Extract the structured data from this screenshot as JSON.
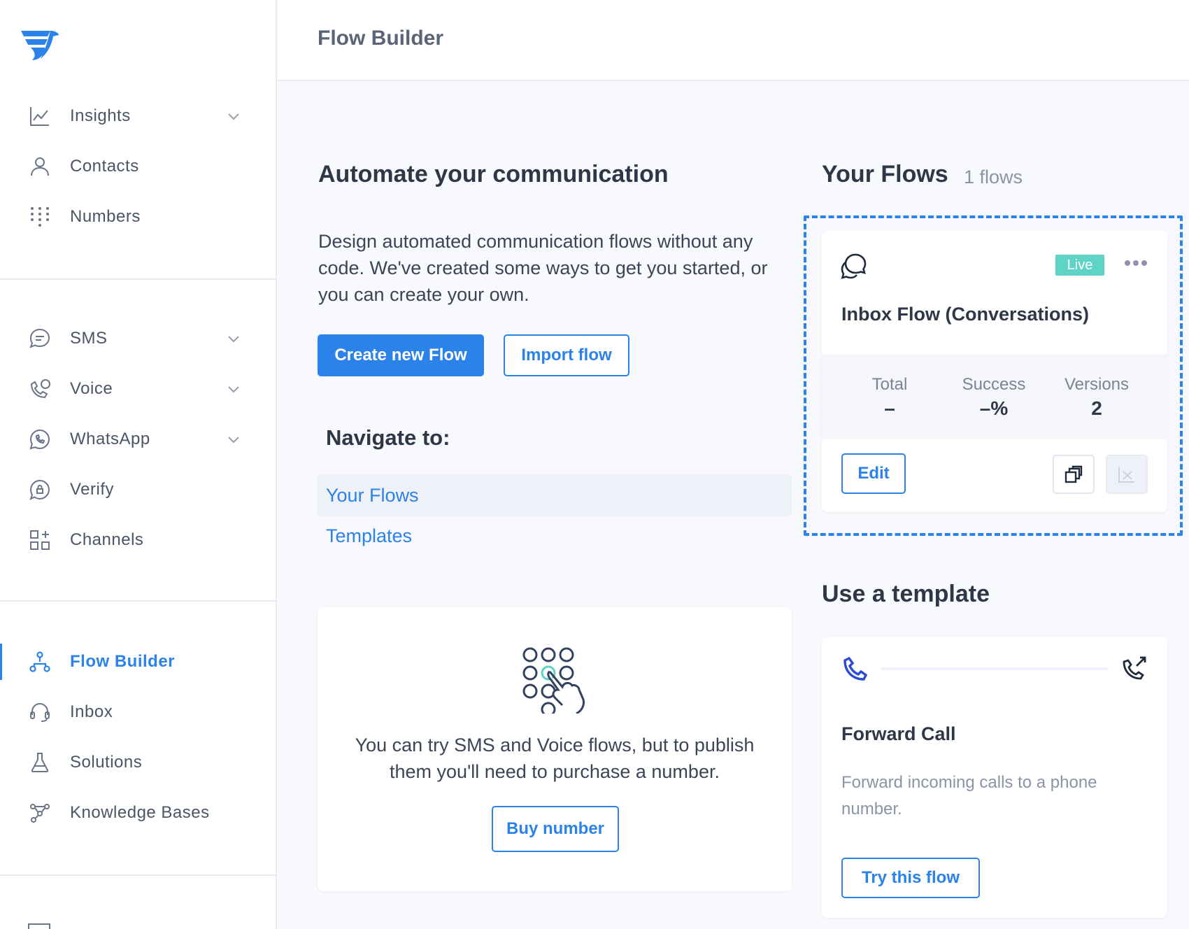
{
  "header": {
    "title": "Flow Builder"
  },
  "sidebar": {
    "group1": [
      {
        "label": "Insights",
        "icon": "chart-line-icon",
        "has_chevron": true
      },
      {
        "label": "Contacts",
        "icon": "person-icon",
        "has_chevron": false
      },
      {
        "label": "Numbers",
        "icon": "dialpad-icon",
        "has_chevron": false
      }
    ],
    "group2": [
      {
        "label": "SMS",
        "icon": "chat-bubble-icon",
        "has_chevron": true
      },
      {
        "label": "Voice",
        "icon": "phone-voice-icon",
        "has_chevron": true
      },
      {
        "label": "WhatsApp",
        "icon": "whatsapp-icon",
        "has_chevron": true
      },
      {
        "label": "Verify",
        "icon": "lock-bubble-icon",
        "has_chevron": false
      },
      {
        "label": "Channels",
        "icon": "grid-plus-icon",
        "has_chevron": false
      }
    ],
    "group3": [
      {
        "label": "Flow Builder",
        "icon": "flow-icon",
        "active": true
      },
      {
        "label": "Inbox",
        "icon": "headset-icon"
      },
      {
        "label": "Solutions",
        "icon": "flask-icon"
      },
      {
        "label": "Knowledge Bases",
        "icon": "network-icon"
      }
    ]
  },
  "main": {
    "heading": "Automate your communication",
    "description": "Design automated communication flows without any code. We've created some ways to get you started, or you can create your own.",
    "create_button": "Create new Flow",
    "import_button": "Import flow",
    "navigate_heading": "Navigate to:",
    "nav_links": [
      {
        "label": "Your Flows",
        "selected": true
      },
      {
        "label": "Templates",
        "selected": false
      }
    ],
    "info_card": {
      "text": "You can try SMS and Voice flows, but to publish them you'll need to purchase a number.",
      "button": "Buy number"
    }
  },
  "flows": {
    "heading": "Your Flows",
    "count": "1 flows",
    "card": {
      "status": "Live",
      "name": "Inbox Flow (Conversations)",
      "stats": [
        {
          "label": "Total",
          "value": "–"
        },
        {
          "label": "Success",
          "value": "–%"
        },
        {
          "label": "Versions",
          "value": "2"
        }
      ],
      "edit_button": "Edit"
    }
  },
  "templates": {
    "heading": "Use a template",
    "card": {
      "name": "Forward Call",
      "description": "Forward incoming calls to a phone number.",
      "button": "Try this flow"
    }
  },
  "colors": {
    "accent": "#2b82e8",
    "live_badge": "#5fd3c6",
    "background": "#f7f9fc"
  }
}
